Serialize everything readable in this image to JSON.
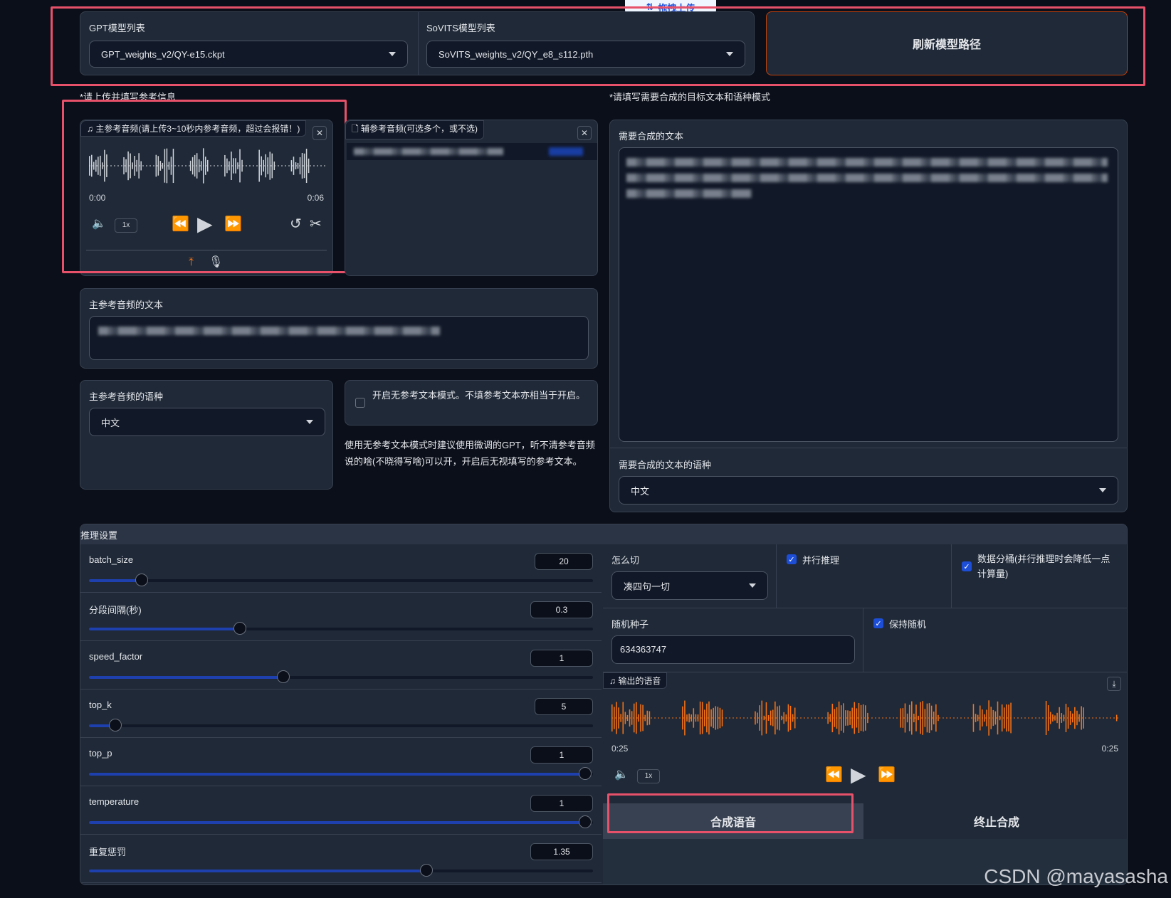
{
  "top": {
    "upload_badge": "拖拽上传",
    "gpt_label": "GPT模型列表",
    "gpt_value": "GPT_weights_v2/QY-e15.ckpt",
    "sovits_label": "SoVITS模型列表",
    "sovits_value": "SoVITS_weights_v2/QY_e8_s112.pth",
    "refresh_button": "刷新模型路径"
  },
  "reference": {
    "hint": "*请上传并填写参考信息",
    "main_audio_label": "主参考音频(请上传3~10秒内参考音频，超过会报错！)",
    "time_start": "0:00",
    "time_end": "0:06",
    "playback_rate": "1x",
    "aux_audio_label": "辅参考音频(可选多个，或不选)",
    "ref_text_label": "主参考音频的文本",
    "ref_lang_label": "主参考音频的语种",
    "ref_lang_value": "中文",
    "no_ref_checkbox_label": "开启无参考文本模式。不填参考文本亦相当于开启。",
    "no_ref_checked": false,
    "no_ref_note": "使用无参考文本模式时建议使用微调的GPT，听不清参考音频说的啥(不晓得写啥)可以开，开启后无视填写的参考文本。"
  },
  "target": {
    "hint": "*请填写需要合成的目标文本和语种模式",
    "text_label": "需要合成的文本",
    "lang_label": "需要合成的文本的语种",
    "lang_value": "中文"
  },
  "inference": {
    "title": "推理设置",
    "sliders": [
      {
        "name": "batch_size",
        "value": "20",
        "fraction": 0.105
      },
      {
        "name": "分段间隔(秒)",
        "value": "0.3",
        "fraction": 0.3
      },
      {
        "name": "speed_factor",
        "value": "1",
        "fraction": 0.385
      },
      {
        "name": "top_k",
        "value": "5",
        "fraction": 0.052
      },
      {
        "name": "top_p",
        "value": "1",
        "fraction": 0.985
      },
      {
        "name": "temperature",
        "value": "1",
        "fraction": 0.985
      },
      {
        "name": "重复惩罚",
        "value": "1.35",
        "fraction": 0.67
      }
    ],
    "cut_label": "怎么切",
    "cut_value": "凑四句一切",
    "parallel_label": "并行推理",
    "parallel_checked": true,
    "bucket_label": "数据分桶(并行推理时会降低一点计算量)",
    "bucket_checked": true,
    "seed_label": "随机种子",
    "seed_value": "634363747",
    "keep_random_label": "保持随机",
    "keep_random_checked": true,
    "output_label": "输出的语音",
    "out_time_start": "0:25",
    "out_time_end": "0:25",
    "out_rate": "1x",
    "synth_button": "合成语音",
    "stop_button": "终止合成"
  },
  "watermark": "CSDN @mayasasha",
  "colors": {
    "accent": "#1e40af",
    "waveform_output": "#f97316",
    "waveform_ref": "#d1d5db",
    "highlight": "#e8516a"
  }
}
